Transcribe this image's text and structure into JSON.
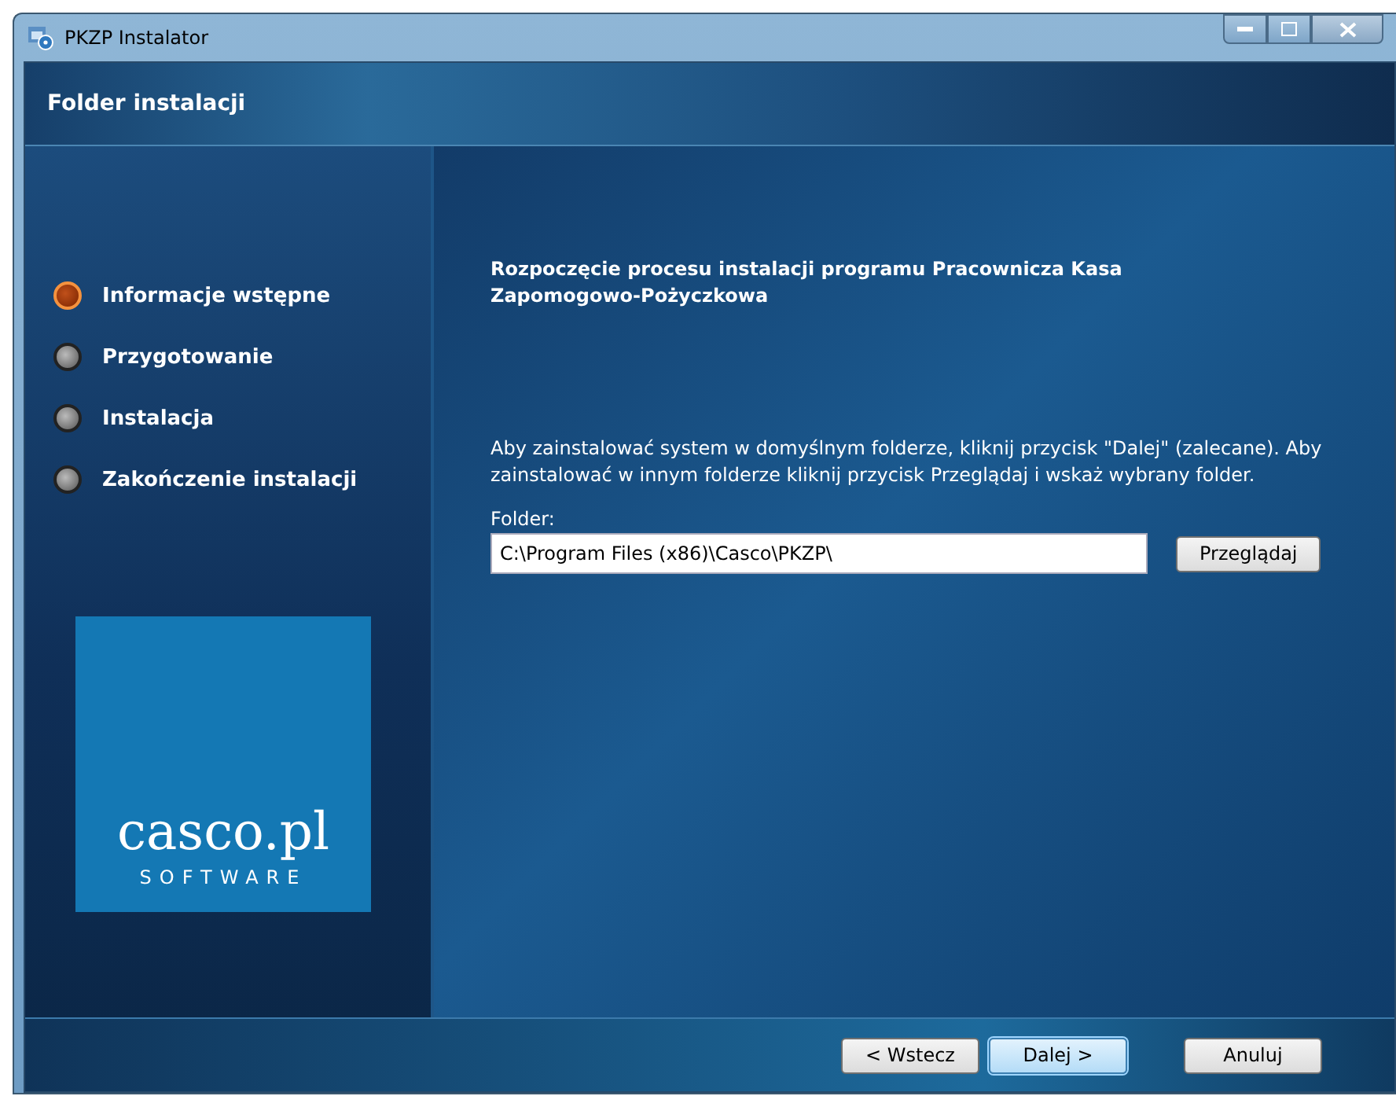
{
  "window": {
    "title": "PKZP Instalator"
  },
  "header": {
    "title": "Folder instalacji"
  },
  "steps": [
    {
      "label": "Informacje wstępne",
      "selected": true
    },
    {
      "label": "Przygotowanie",
      "selected": false
    },
    {
      "label": "Instalacja",
      "selected": false
    },
    {
      "label": "Zakończenie instalacji",
      "selected": false
    }
  ],
  "logo": {
    "name": "casco.pl",
    "tagline": "SOFTWARE"
  },
  "content": {
    "heading": "Rozpoczęcie procesu instalacji programu Pracownicza Kasa Zapomogowo-Pożyczkowa",
    "description": "Aby zainstalować system w domyślnym folderze, kliknij przycisk \"Dalej\" (zalecane). Aby zainstalować w innym folderze kliknij przycisk Przeglądaj i wskaż wybrany folder.",
    "folder_label": "Folder:",
    "folder_value": "C:\\Program Files (x86)\\Casco\\PKZP\\",
    "browse_button": "Przeglądaj"
  },
  "buttons": [
    {
      "label": "< Wstecz",
      "default": false
    },
    {
      "label": "Dalej >",
      "default": true
    },
    {
      "label": "Anuluj",
      "default": false
    }
  ]
}
